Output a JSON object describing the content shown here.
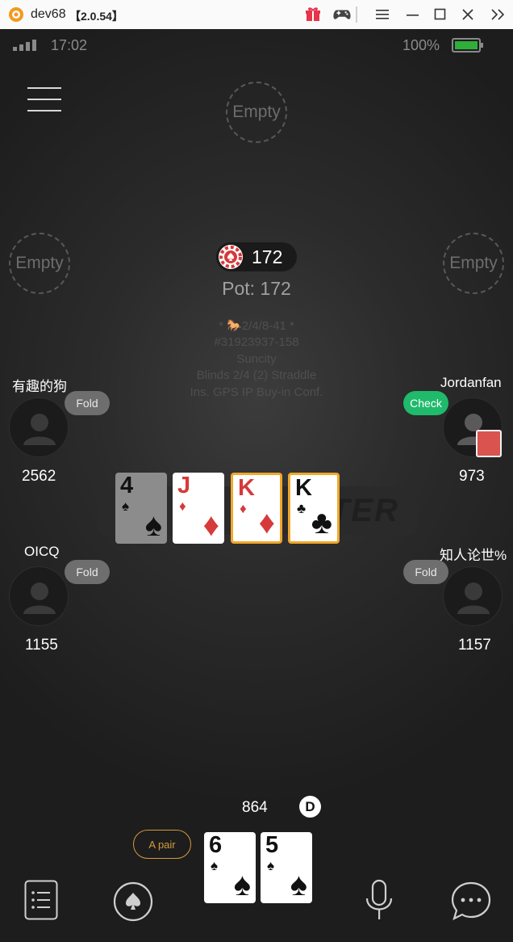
{
  "window": {
    "title": "dev68",
    "version": "【2.0.54】"
  },
  "status_bar": {
    "time": "17:02",
    "battery": "100%"
  },
  "seats_empty": {
    "label": "Empty"
  },
  "pot": {
    "amount": "172",
    "label": "Pot: 172"
  },
  "table_info": {
    "line1": "* 🐎2/4/8-41 *",
    "line2": "#31923937-158",
    "line3": "Suncity",
    "line4": "Blinds 2/4 (2) Straddle",
    "line5": "Ins. GPS IP Buy-in Conf."
  },
  "watermark": "TER",
  "players": {
    "left_top": {
      "name": "有趣的狗",
      "action": "Fold",
      "stack": "2562"
    },
    "left_bottom": {
      "name": "OICQ",
      "action": "Fold",
      "stack": "1155"
    },
    "right_top": {
      "name": "Jordanfan",
      "action": "Check",
      "stack": "973"
    },
    "right_bottom": {
      "name": "知人论世%",
      "action": "Fold",
      "stack": "1157"
    }
  },
  "board": [
    {
      "rank": "4",
      "suit": "♠"
    },
    {
      "rank": "J",
      "suit": "♦"
    },
    {
      "rank": "K",
      "suit": "♦"
    },
    {
      "rank": "K",
      "suit": "♣"
    }
  ],
  "hero": {
    "stack": "864",
    "dealer": "D",
    "hand_strength": "A pair",
    "cards": [
      {
        "rank": "6",
        "suit": "♠"
      },
      {
        "rank": "5",
        "suit": "♠"
      }
    ]
  },
  "colors": {
    "check": "#1fba6b",
    "fold": "#6e6e6e",
    "highlight": "#f0a72a",
    "red_suit": "#d63a3a"
  }
}
